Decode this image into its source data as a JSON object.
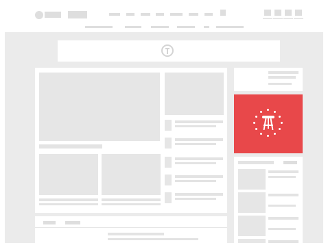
{
  "theme": {
    "background": "#ebebeb",
    "card": "#ffffff",
    "placeholder": "#e6e6e6",
    "line": "#dedede",
    "accent": "#e8484a"
  },
  "header": {
    "logo_icon": "barstool-logo-icon",
    "nav_item_count": 7,
    "action_icon_count": 4,
    "sub_nav_item_count": 6
  },
  "banner": {
    "icon": "barstool-logo-icon"
  },
  "ad": {
    "icon": "barstool-stool-icon"
  }
}
